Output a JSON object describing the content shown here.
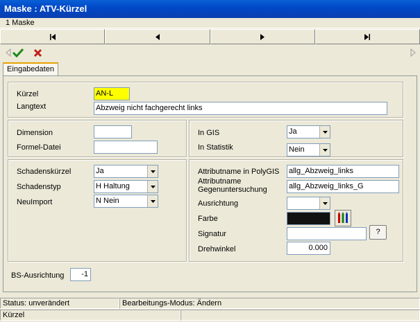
{
  "window": {
    "title": "Maske : ATV-Kürzel"
  },
  "menu": {
    "item": "1 Maske"
  },
  "nav": {
    "first": "first-record-icon",
    "prev": "prev-record-icon",
    "next": "next-record-icon",
    "last": "last-record-icon"
  },
  "toolbar": {
    "ok_icon": "check-icon",
    "cancel_icon": "cross-icon"
  },
  "tabs": [
    {
      "label": "Eingabedaten"
    }
  ],
  "basic": {
    "kuerzel_label": "Kürzel",
    "kuerzel_value": "AN-L",
    "langtext_label": "Langtext",
    "langtext_value": "Abzweig nicht fachgerecht links"
  },
  "dim": {
    "dimension_label": "Dimension",
    "dimension_value": "",
    "formel_label": "Formel-Datei",
    "formel_value": ""
  },
  "gis": {
    "ingis_label": "In GIS",
    "ingis_value": "Ja",
    "instat_label": "In Statistik",
    "instat_value": "Nein"
  },
  "schaden": {
    "kuerzel_label": "Schadenskürzel",
    "kuerzel_value": "Ja",
    "typ_label": "Schadenstyp",
    "typ_value": "H Haltung",
    "neu_label": "NeuImport",
    "neu_value": "N Nein"
  },
  "attr": {
    "poly_label": "Attributname in PolyGIS",
    "poly_value": "allg_Abzweig_links",
    "gegen_label_1": "Attributname",
    "gegen_label_2": "Gegenuntersuchung",
    "gegen_value": "allg_Abzweig_links_G",
    "ausrichtung_label": "Ausrichtung",
    "ausrichtung_value": "",
    "farbe_label": "Farbe",
    "farbe_color": "#111111",
    "signatur_label": "Signatur",
    "signatur_value": "",
    "signatur_btn": "?",
    "dreh_label": "Drehwinkel",
    "dreh_value": "0.000"
  },
  "bs": {
    "label": "BS-Ausrichtung",
    "value": "-1"
  },
  "status": {
    "state": "Status: unverändert",
    "mode": "Bearbeitungs-Modus: Ändern",
    "bottom": "Kürzel"
  }
}
